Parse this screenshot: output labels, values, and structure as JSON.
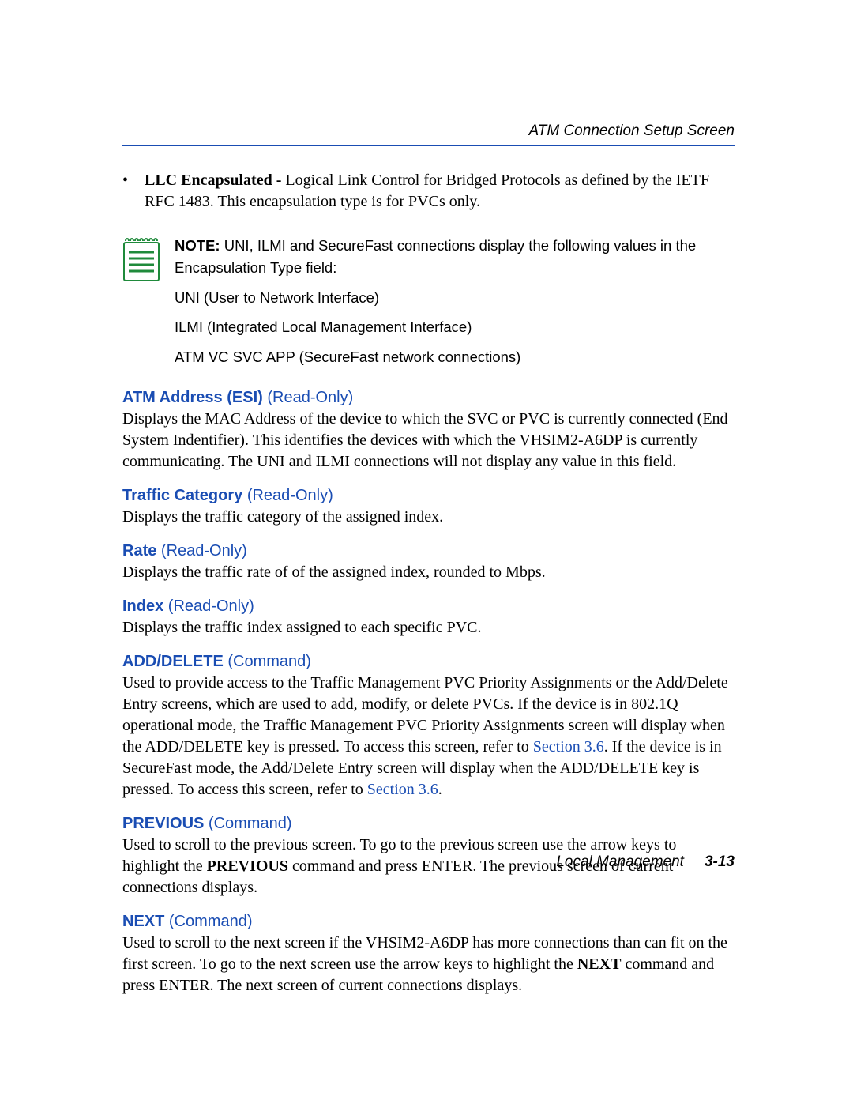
{
  "header": {
    "title": "ATM Connection Setup Screen"
  },
  "bullet": {
    "term": "LLC Encapsulated",
    "dash": " - ",
    "text": "Logical Link Control for Bridged Protocols as defined by the IETF RFC 1483. This encapsulation type is for PVCs only."
  },
  "note": {
    "label": "NOTE:",
    "intro": " UNI, ILMI and SecureFast connections display the following values in the Encapsulation Type field:",
    "lines": [
      "UNI (User to Network Interface)",
      "ILMI (Integrated Local Management Interface)",
      "ATM VC SVC APP (SecureFast network connections)"
    ]
  },
  "sections": [
    {
      "head": "ATM Address (ESI)",
      "qual": " (Read-Only)",
      "body_pre": "Displays the MAC Address of the device to which the SVC or PVC is currently connected (End System Indentifier). This identifies the devices with which the VHSIM2-A6DP is currently communicating. The UNI and ILMI connections will not display any value in this field.",
      "xref": "",
      "body_post": ""
    },
    {
      "head": "Traffic Category",
      "qual": " (Read-Only)",
      "body_pre": "Displays the traffic category of the assigned index.",
      "xref": "",
      "body_post": ""
    },
    {
      "head": "Rate",
      "qual": " (Read-Only)",
      "body_pre": "Displays the traffic rate of of the assigned index, rounded to Mbps.",
      "xref": "",
      "body_post": ""
    },
    {
      "head": "Index",
      "qual": " (Read-Only)",
      "body_pre": "Displays the traffic index assigned to each specific PVC.",
      "xref": "",
      "body_post": ""
    }
  ],
  "add_delete": {
    "head": "ADD/DELETE",
    "qual": " (Command)",
    "body_a": "Used to provide access to the Traffic Management PVC Priority Assignments or the Add/Delete Entry screens, which are used to add, modify, or delete PVCs. If the device is in 802.1Q operational mode, the Traffic Management PVC Priority Assignments screen will display when the ADD/DELETE key is pressed. To access this screen, refer to ",
    "xref_a": "Section 3.6",
    "body_b": ". If the device is in SecureFast mode, the Add/Delete Entry screen will display when the ADD/DELETE key is pressed. To access this screen, refer to ",
    "xref_b": "Section 3.6",
    "body_c": "."
  },
  "previous": {
    "head": "PREVIOUS",
    "qual": " (Command)",
    "body_a": "Used to scroll to the previous screen. To go to the previous screen use the arrow keys to highlight the ",
    "strong": "PREVIOUS",
    "body_b": " command and press ENTER. The previous screen of current connections displays."
  },
  "next": {
    "head": "NEXT",
    "qual": " (Command)",
    "body_a": "Used to scroll to the next screen if the VHSIM2-A6DP has more connections than can fit on the first screen. To go to the next screen use the arrow keys to highlight the ",
    "strong": "NEXT",
    "body_b": " command and press ENTER. The next screen of current connections displays."
  },
  "footer": {
    "label": "Local Management",
    "page": "3-13"
  }
}
